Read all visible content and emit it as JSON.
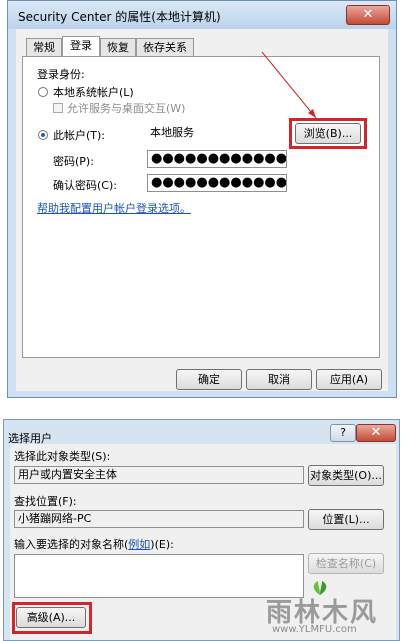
{
  "dialog1": {
    "title": "Security Center 的属性(本地计算机)",
    "close_glyph": "✕",
    "tabs": [
      "常规",
      "登录",
      "恢复",
      "依存关系"
    ],
    "login_as_label": "登录身份:",
    "local_system_label": "本地系统帐户(L)",
    "allow_desktop_label": "允许服务与桌面交互(W)",
    "this_account_label": "此帐户(T):",
    "this_account_value": "本地服务",
    "browse_button": "浏览(B)...",
    "password_label": "密码(P):",
    "password_value": "●●●●●●●●●●●●●●●",
    "confirm_password_label": "确认密码(C):",
    "confirm_password_value": "●●●●●●●●●●●●●●●",
    "help_link": "帮助我配置用户帐户登录选项。",
    "ok_button": "确定",
    "cancel_button": "取消",
    "apply_button": "应用(A)"
  },
  "dialog2": {
    "title": "选择用户",
    "help_glyph": "?",
    "close_glyph": "✕",
    "object_type_label": "选择此对象类型(S):",
    "object_type_value": "用户或内置安全主体",
    "object_type_button": "对象类型(O)...",
    "location_label": "查找位置(F):",
    "location_value": "小猪蹦网络-PC",
    "location_button": "位置(L)...",
    "enter_names_prefix": "输入要选择的对象名称(",
    "enter_names_link": "例如",
    "enter_names_suffix": ")(E):",
    "check_names_button": "检查名称(C)",
    "advanced_button": "高级(A)..."
  },
  "watermark": {
    "text": "雨林木风",
    "url": "www.YLMFU.com"
  },
  "colors": {
    "highlight_box": "#d0272b",
    "link": "#1a55b6",
    "close_button": "#c44a36"
  }
}
